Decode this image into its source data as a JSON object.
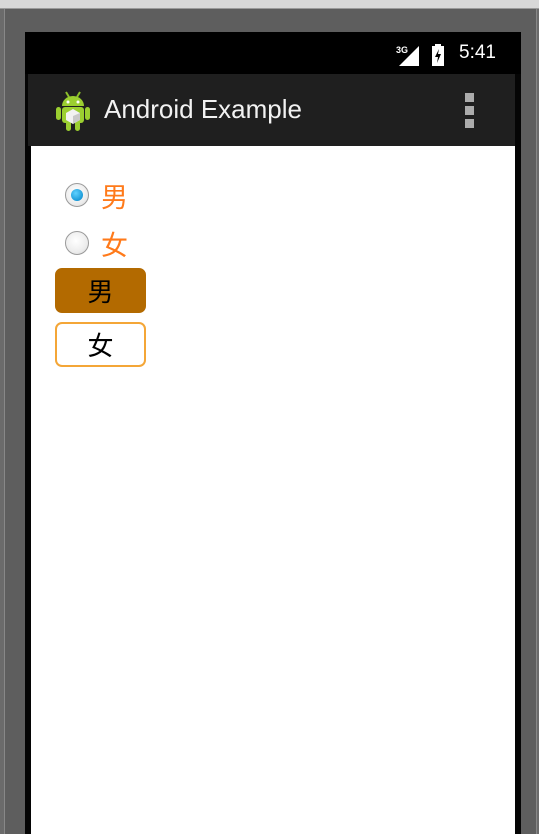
{
  "status_bar": {
    "network": "3G",
    "time": "5:41"
  },
  "action_bar": {
    "title": "Android Example",
    "app_icon": "android-robot-icon",
    "menu_icon": "overflow-menu-icon"
  },
  "radio_group": {
    "options": [
      {
        "label": "男",
        "checked": true
      },
      {
        "label": "女",
        "checked": false
      }
    ]
  },
  "toggle_buttons": [
    {
      "label": "男",
      "selected": true
    },
    {
      "label": "女",
      "selected": false
    }
  ],
  "colors": {
    "label_text": "#ff7a1a",
    "selected_button": "#b36a00",
    "unselected_button_border": "#f4a637",
    "radio_accent": "#1a9ad8",
    "action_bar": "#1f1f1f"
  }
}
